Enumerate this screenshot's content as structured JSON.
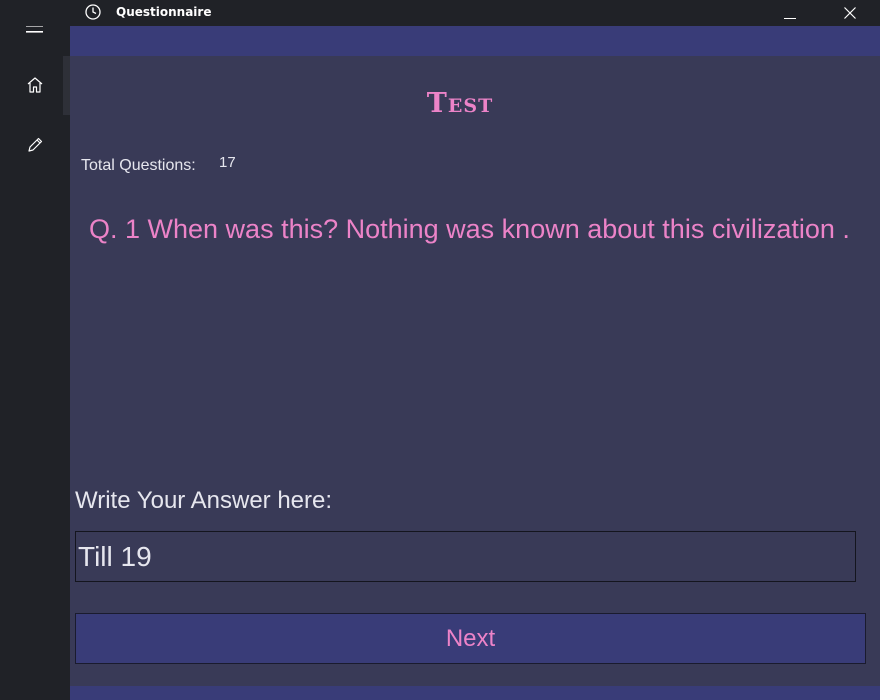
{
  "window": {
    "title": "Questionnaire",
    "clock_icon": "clock-icon",
    "minimize_icon": "minimize-icon",
    "close_icon": "close-icon"
  },
  "sidebar": {
    "items": [
      {
        "icon": "hamburger-menu-icon"
      },
      {
        "icon": "home-icon",
        "selected": true
      },
      {
        "icon": "pencil-icon"
      }
    ]
  },
  "main": {
    "title": "Test",
    "total_label": "Total Questions:",
    "total_value": "17",
    "question": "Q. 1  When was this? Nothing was known about this civilization .",
    "answer_label": "Write Your Answer here:",
    "answer_value": "Till 19",
    "next_label": "Next"
  },
  "colors": {
    "accent_pink": "#ec83c8",
    "content_bg": "#393a57",
    "band_bg": "#393c78",
    "sidebar_bg": "#202227"
  }
}
